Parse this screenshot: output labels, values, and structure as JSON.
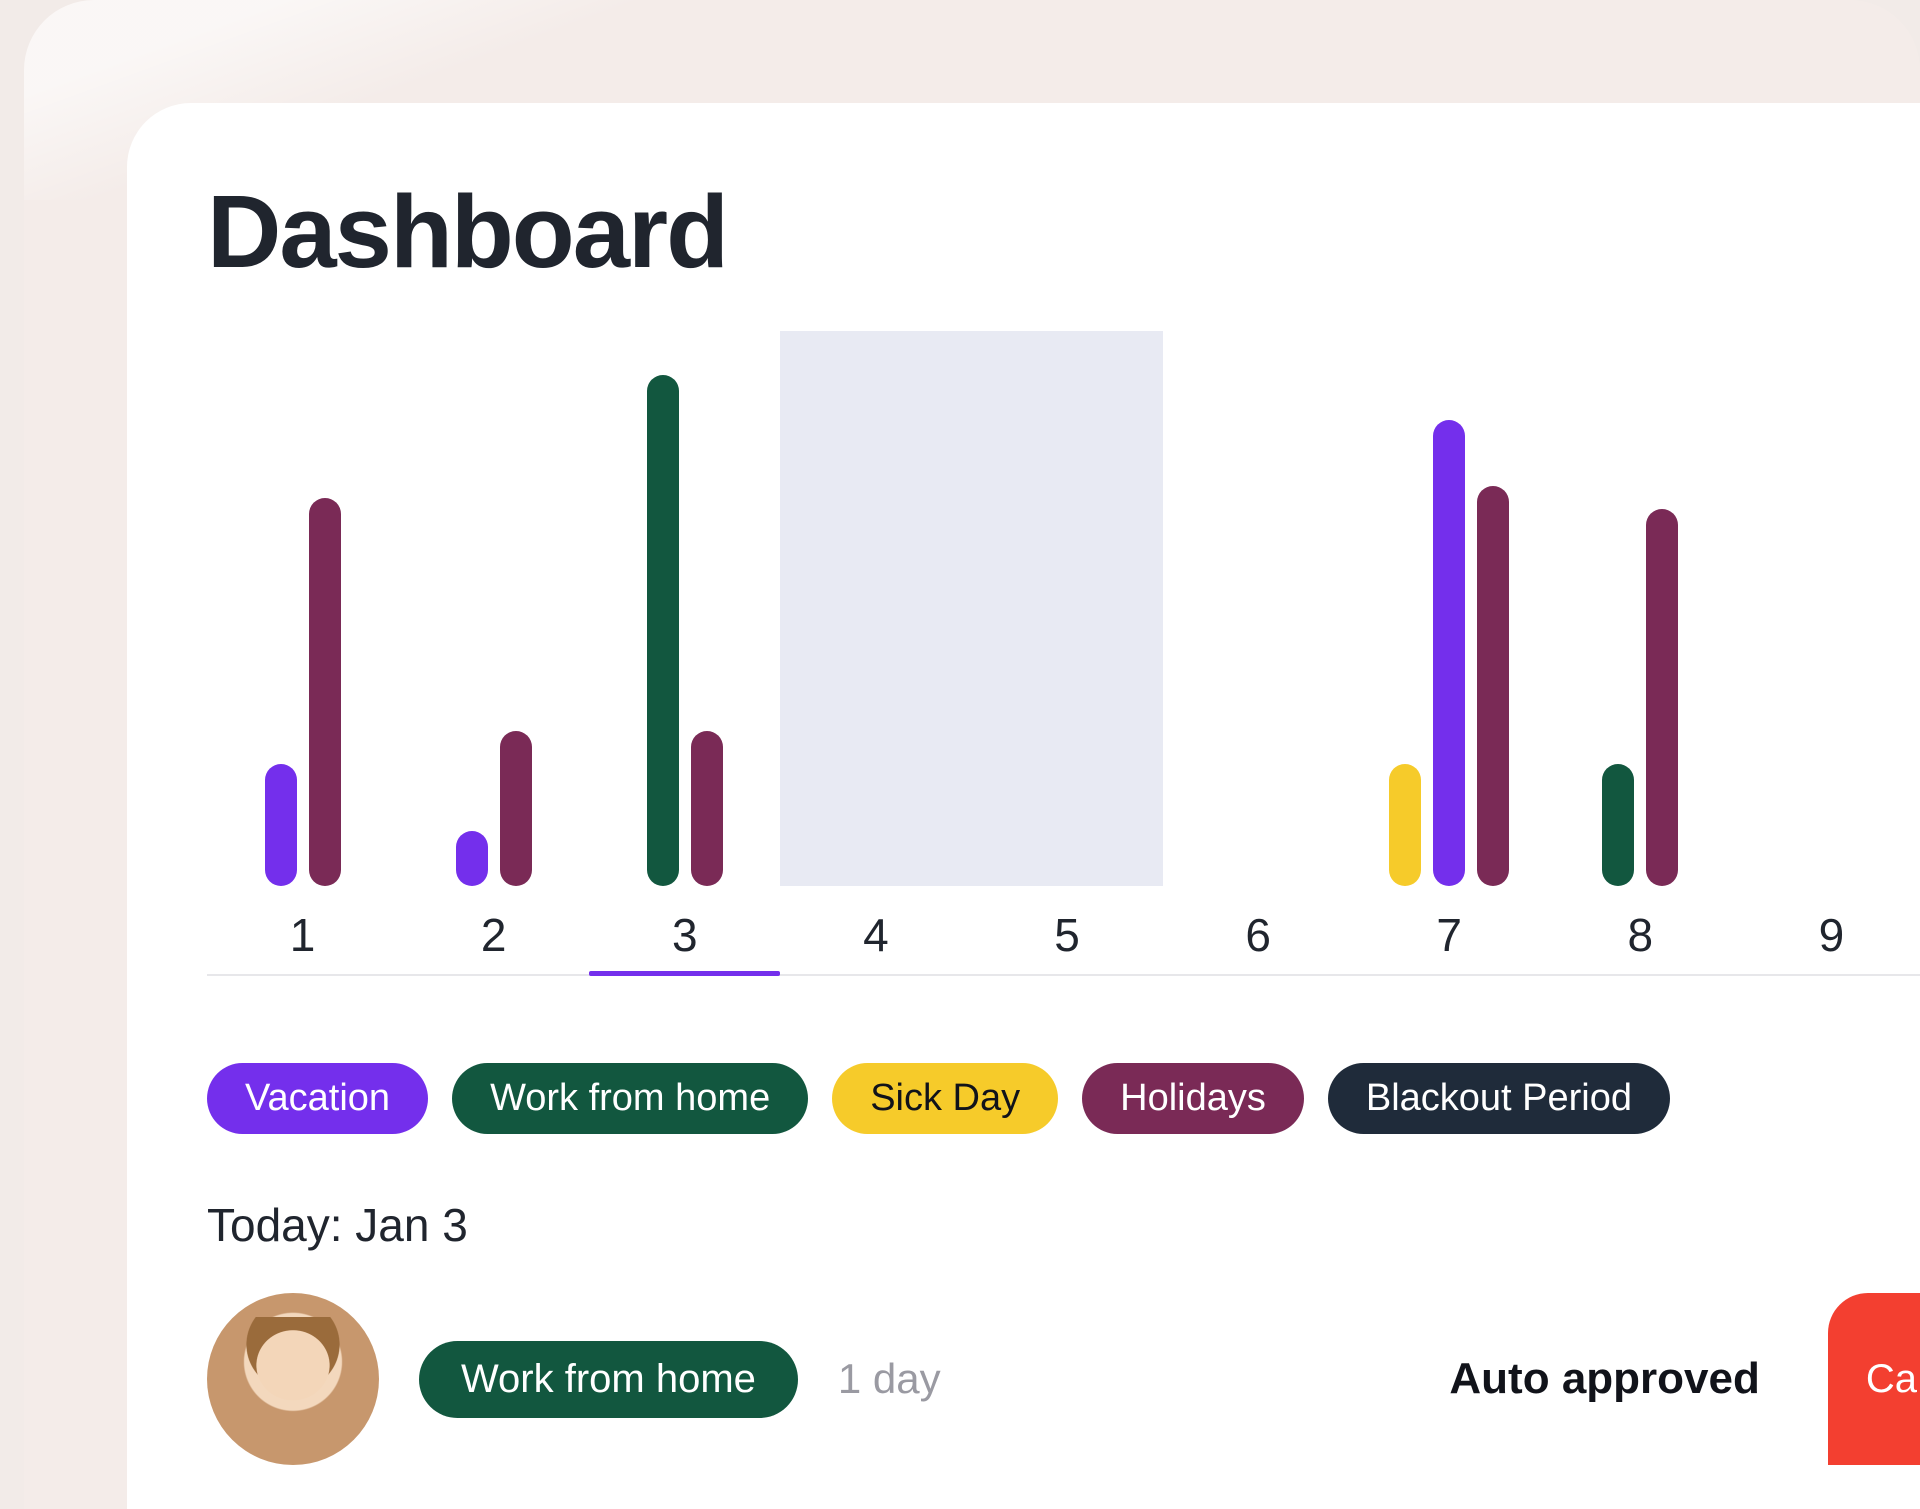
{
  "colors": {
    "vacation": "#742fec",
    "work_from_home": "#12573f",
    "sick_day": "#f6cb2a",
    "holidays": "#7a2a56",
    "blackout_bg": "#e8eaf3",
    "blackout_pill": "#1f2b3a",
    "red": "#f33f30"
  },
  "page": {
    "title": "Dashboard"
  },
  "chart_data": {
    "type": "bar",
    "categories": [
      "1",
      "2",
      "3",
      "4",
      "5",
      "6",
      "7",
      "8",
      "9"
    ],
    "x_highlight_index": 2,
    "blackout_range": [
      3,
      4
    ],
    "series": [
      {
        "name": "Sick Day",
        "color_key": "sick_day",
        "values": [
          0,
          0,
          0,
          0,
          0,
          0,
          1.1,
          0,
          0
        ]
      },
      {
        "name": "Vacation",
        "color_key": "vacation",
        "values": [
          1.1,
          0.5,
          0,
          0,
          0,
          0,
          4.2,
          0,
          0
        ]
      },
      {
        "name": "Work from home",
        "color_key": "work_from_home",
        "values": [
          0,
          0,
          4.6,
          0,
          0,
          0,
          0,
          1.1,
          0
        ]
      },
      {
        "name": "Holidays",
        "color_key": "holidays",
        "values": [
          3.5,
          1.4,
          1.4,
          0,
          0,
          0,
          3.6,
          3.4,
          0
        ]
      }
    ],
    "ymax": 5,
    "title": "",
    "xlabel": "",
    "ylabel": ""
  },
  "legend": [
    {
      "label": "Vacation",
      "bg_key": "vacation",
      "fg": "#ffffff"
    },
    {
      "label": "Work from home",
      "bg_key": "work_from_home",
      "fg": "#ffffff"
    },
    {
      "label": "Sick Day",
      "bg_key": "sick_day",
      "fg": "#11131a"
    },
    {
      "label": "Holidays",
      "bg_key": "holidays",
      "fg": "#ffffff"
    },
    {
      "label": "Blackout Period",
      "bg_key": "blackout_pill",
      "fg": "#ffffff"
    }
  ],
  "today": {
    "label": "Today: Jan 3",
    "entry": {
      "type_label": "Work from home",
      "type_bg_key": "work_from_home",
      "type_fg": "#ffffff",
      "duration": "1 day",
      "status": "Auto approved",
      "action_label": "Ca"
    }
  }
}
